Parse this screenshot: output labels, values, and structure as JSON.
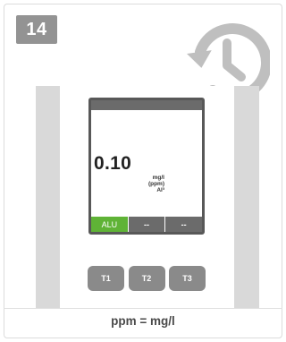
{
  "step": {
    "number": "14"
  },
  "icons": {
    "history": "history-icon"
  },
  "device": {
    "reading": {
      "value": "0.10",
      "unit_line1": "mg/l",
      "unit_line2": "(ppm)",
      "unit_line3": "Al³"
    },
    "tabs": [
      {
        "label": "ALU",
        "active": true
      },
      {
        "label": "--",
        "active": false
      },
      {
        "label": "--",
        "active": false
      }
    ],
    "buttons": [
      {
        "label": "T1"
      },
      {
        "label": "T2"
      },
      {
        "label": "T3"
      }
    ]
  },
  "caption": "ppm = mg/l",
  "colors": {
    "badge": "#939393",
    "active_tab": "#5fb336",
    "screen_frame": "#585858",
    "button": "#8a8a8a",
    "icon": "#bfbfbf"
  }
}
